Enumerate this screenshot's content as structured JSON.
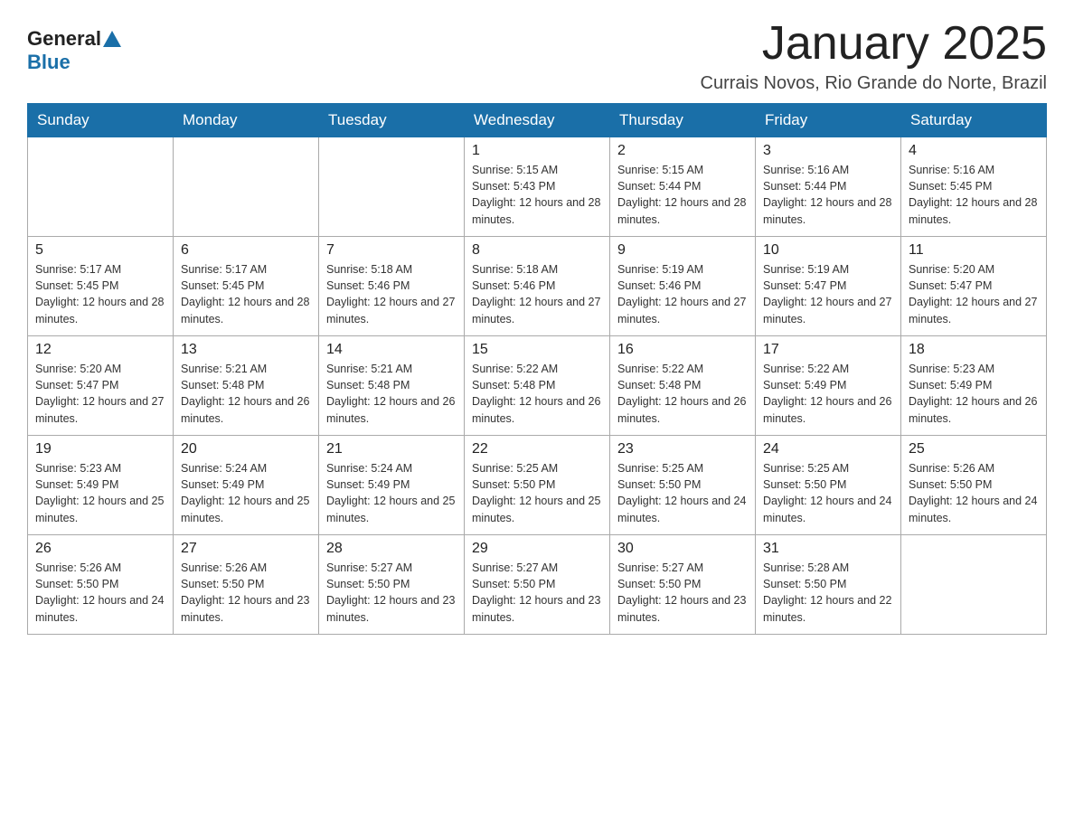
{
  "header": {
    "logo_general": "General",
    "logo_blue": "Blue",
    "month_title": "January 2025",
    "location": "Currais Novos, Rio Grande do Norte, Brazil"
  },
  "days_of_week": [
    "Sunday",
    "Monday",
    "Tuesday",
    "Wednesday",
    "Thursday",
    "Friday",
    "Saturday"
  ],
  "weeks": [
    [
      {
        "day": "",
        "info": ""
      },
      {
        "day": "",
        "info": ""
      },
      {
        "day": "",
        "info": ""
      },
      {
        "day": "1",
        "info": "Sunrise: 5:15 AM\nSunset: 5:43 PM\nDaylight: 12 hours and 28 minutes."
      },
      {
        "day": "2",
        "info": "Sunrise: 5:15 AM\nSunset: 5:44 PM\nDaylight: 12 hours and 28 minutes."
      },
      {
        "day": "3",
        "info": "Sunrise: 5:16 AM\nSunset: 5:44 PM\nDaylight: 12 hours and 28 minutes."
      },
      {
        "day": "4",
        "info": "Sunrise: 5:16 AM\nSunset: 5:45 PM\nDaylight: 12 hours and 28 minutes."
      }
    ],
    [
      {
        "day": "5",
        "info": "Sunrise: 5:17 AM\nSunset: 5:45 PM\nDaylight: 12 hours and 28 minutes."
      },
      {
        "day": "6",
        "info": "Sunrise: 5:17 AM\nSunset: 5:45 PM\nDaylight: 12 hours and 28 minutes."
      },
      {
        "day": "7",
        "info": "Sunrise: 5:18 AM\nSunset: 5:46 PM\nDaylight: 12 hours and 27 minutes."
      },
      {
        "day": "8",
        "info": "Sunrise: 5:18 AM\nSunset: 5:46 PM\nDaylight: 12 hours and 27 minutes."
      },
      {
        "day": "9",
        "info": "Sunrise: 5:19 AM\nSunset: 5:46 PM\nDaylight: 12 hours and 27 minutes."
      },
      {
        "day": "10",
        "info": "Sunrise: 5:19 AM\nSunset: 5:47 PM\nDaylight: 12 hours and 27 minutes."
      },
      {
        "day": "11",
        "info": "Sunrise: 5:20 AM\nSunset: 5:47 PM\nDaylight: 12 hours and 27 minutes."
      }
    ],
    [
      {
        "day": "12",
        "info": "Sunrise: 5:20 AM\nSunset: 5:47 PM\nDaylight: 12 hours and 27 minutes."
      },
      {
        "day": "13",
        "info": "Sunrise: 5:21 AM\nSunset: 5:48 PM\nDaylight: 12 hours and 26 minutes."
      },
      {
        "day": "14",
        "info": "Sunrise: 5:21 AM\nSunset: 5:48 PM\nDaylight: 12 hours and 26 minutes."
      },
      {
        "day": "15",
        "info": "Sunrise: 5:22 AM\nSunset: 5:48 PM\nDaylight: 12 hours and 26 minutes."
      },
      {
        "day": "16",
        "info": "Sunrise: 5:22 AM\nSunset: 5:48 PM\nDaylight: 12 hours and 26 minutes."
      },
      {
        "day": "17",
        "info": "Sunrise: 5:22 AM\nSunset: 5:49 PM\nDaylight: 12 hours and 26 minutes."
      },
      {
        "day": "18",
        "info": "Sunrise: 5:23 AM\nSunset: 5:49 PM\nDaylight: 12 hours and 26 minutes."
      }
    ],
    [
      {
        "day": "19",
        "info": "Sunrise: 5:23 AM\nSunset: 5:49 PM\nDaylight: 12 hours and 25 minutes."
      },
      {
        "day": "20",
        "info": "Sunrise: 5:24 AM\nSunset: 5:49 PM\nDaylight: 12 hours and 25 minutes."
      },
      {
        "day": "21",
        "info": "Sunrise: 5:24 AM\nSunset: 5:49 PM\nDaylight: 12 hours and 25 minutes."
      },
      {
        "day": "22",
        "info": "Sunrise: 5:25 AM\nSunset: 5:50 PM\nDaylight: 12 hours and 25 minutes."
      },
      {
        "day": "23",
        "info": "Sunrise: 5:25 AM\nSunset: 5:50 PM\nDaylight: 12 hours and 24 minutes."
      },
      {
        "day": "24",
        "info": "Sunrise: 5:25 AM\nSunset: 5:50 PM\nDaylight: 12 hours and 24 minutes."
      },
      {
        "day": "25",
        "info": "Sunrise: 5:26 AM\nSunset: 5:50 PM\nDaylight: 12 hours and 24 minutes."
      }
    ],
    [
      {
        "day": "26",
        "info": "Sunrise: 5:26 AM\nSunset: 5:50 PM\nDaylight: 12 hours and 24 minutes."
      },
      {
        "day": "27",
        "info": "Sunrise: 5:26 AM\nSunset: 5:50 PM\nDaylight: 12 hours and 23 minutes."
      },
      {
        "day": "28",
        "info": "Sunrise: 5:27 AM\nSunset: 5:50 PM\nDaylight: 12 hours and 23 minutes."
      },
      {
        "day": "29",
        "info": "Sunrise: 5:27 AM\nSunset: 5:50 PM\nDaylight: 12 hours and 23 minutes."
      },
      {
        "day": "30",
        "info": "Sunrise: 5:27 AM\nSunset: 5:50 PM\nDaylight: 12 hours and 23 minutes."
      },
      {
        "day": "31",
        "info": "Sunrise: 5:28 AM\nSunset: 5:50 PM\nDaylight: 12 hours and 22 minutes."
      },
      {
        "day": "",
        "info": ""
      }
    ]
  ]
}
